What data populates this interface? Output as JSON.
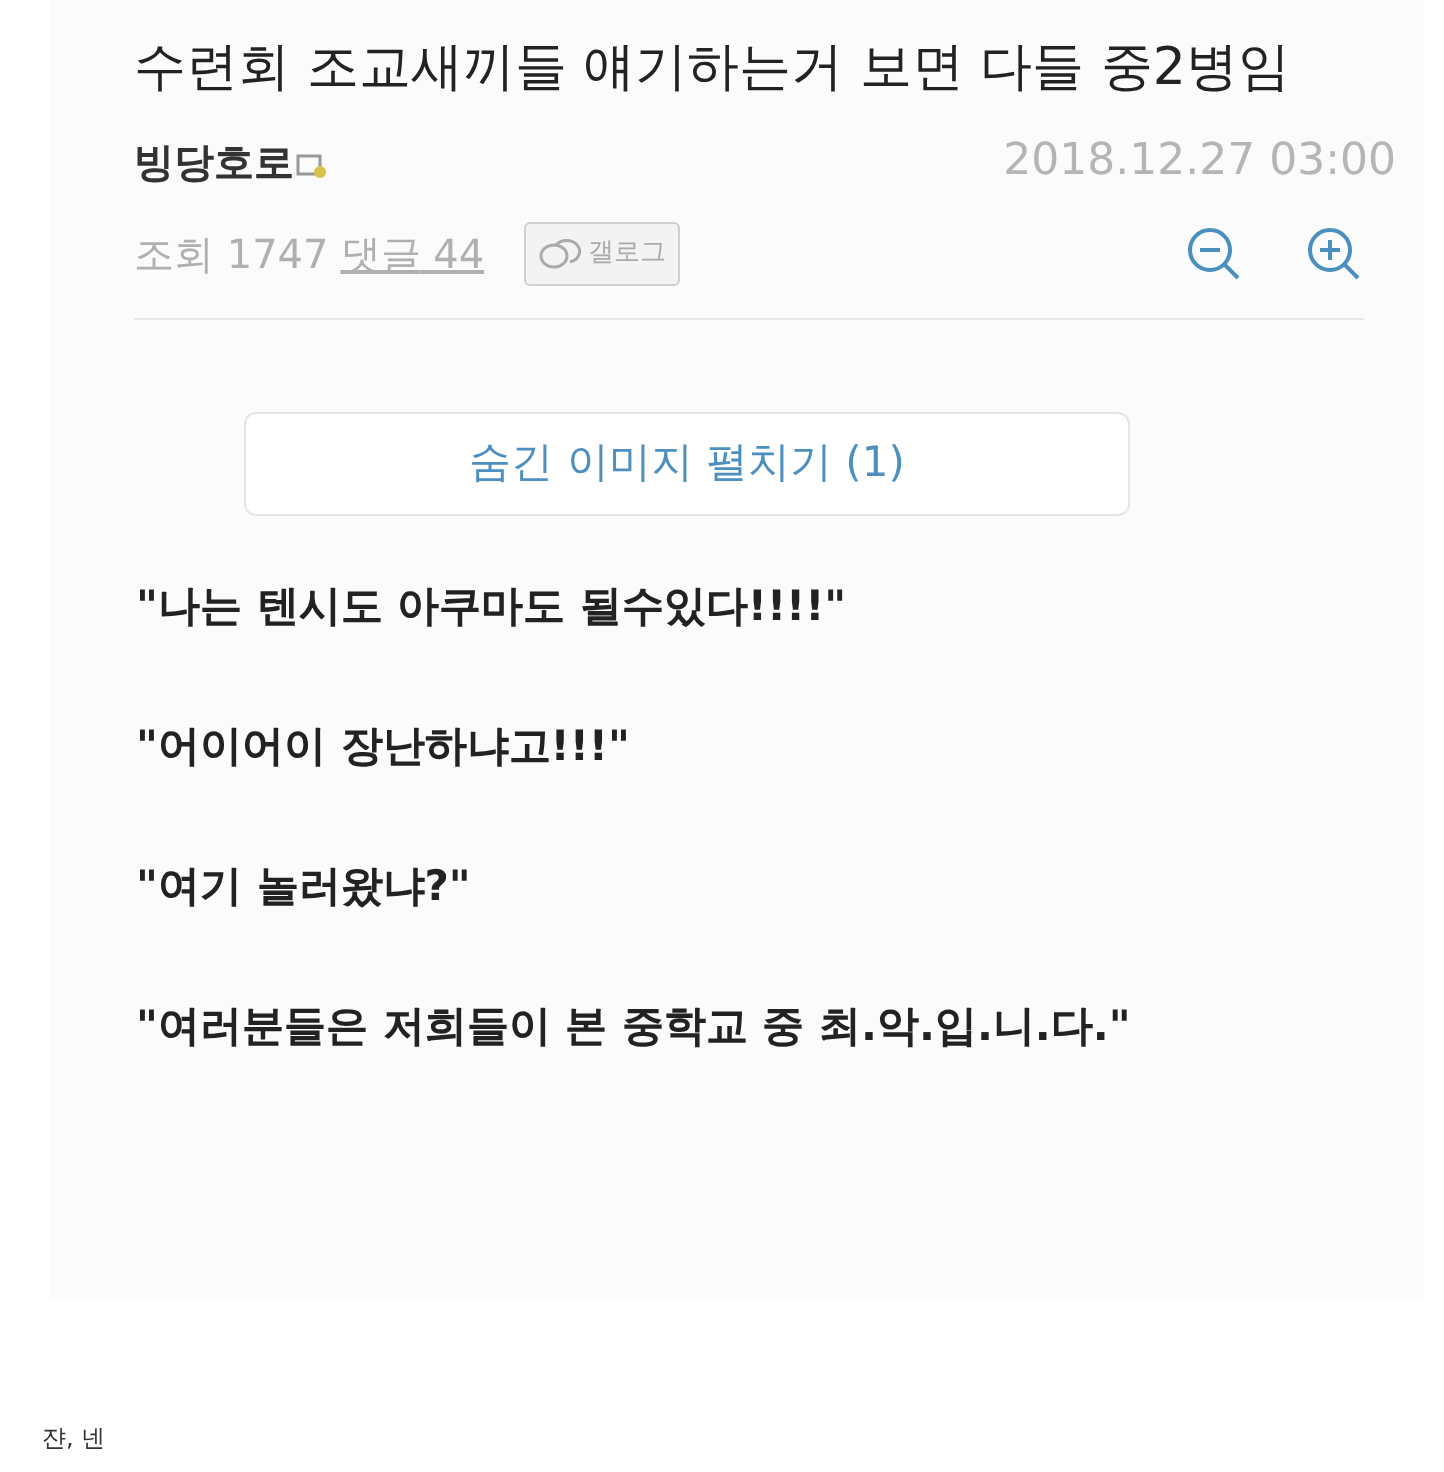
{
  "post": {
    "title": "수련회 조교새끼들 얘기하는거 보면 다들 중2병임",
    "author": "빙당호로",
    "date": "2018.12.27 03:00",
    "views_label": "조회",
    "views": "1747",
    "comments_label": "댓글",
    "comments": "44",
    "gallog": "갤로그",
    "hidden_images_button": "숨긴 이미지 펼치기 (1)",
    "lines": [
      "\"나는 텐시도 아쿠마도 될수있다!!!!\"",
      "\"어이어이 장난하냐고!!!\"",
      "\"여기 놀러왔냐?\"",
      "\"여러분들은 저희들이 본 중학교 중 최.악.입.니.다.\""
    ]
  },
  "caption": "쟌, 넨"
}
